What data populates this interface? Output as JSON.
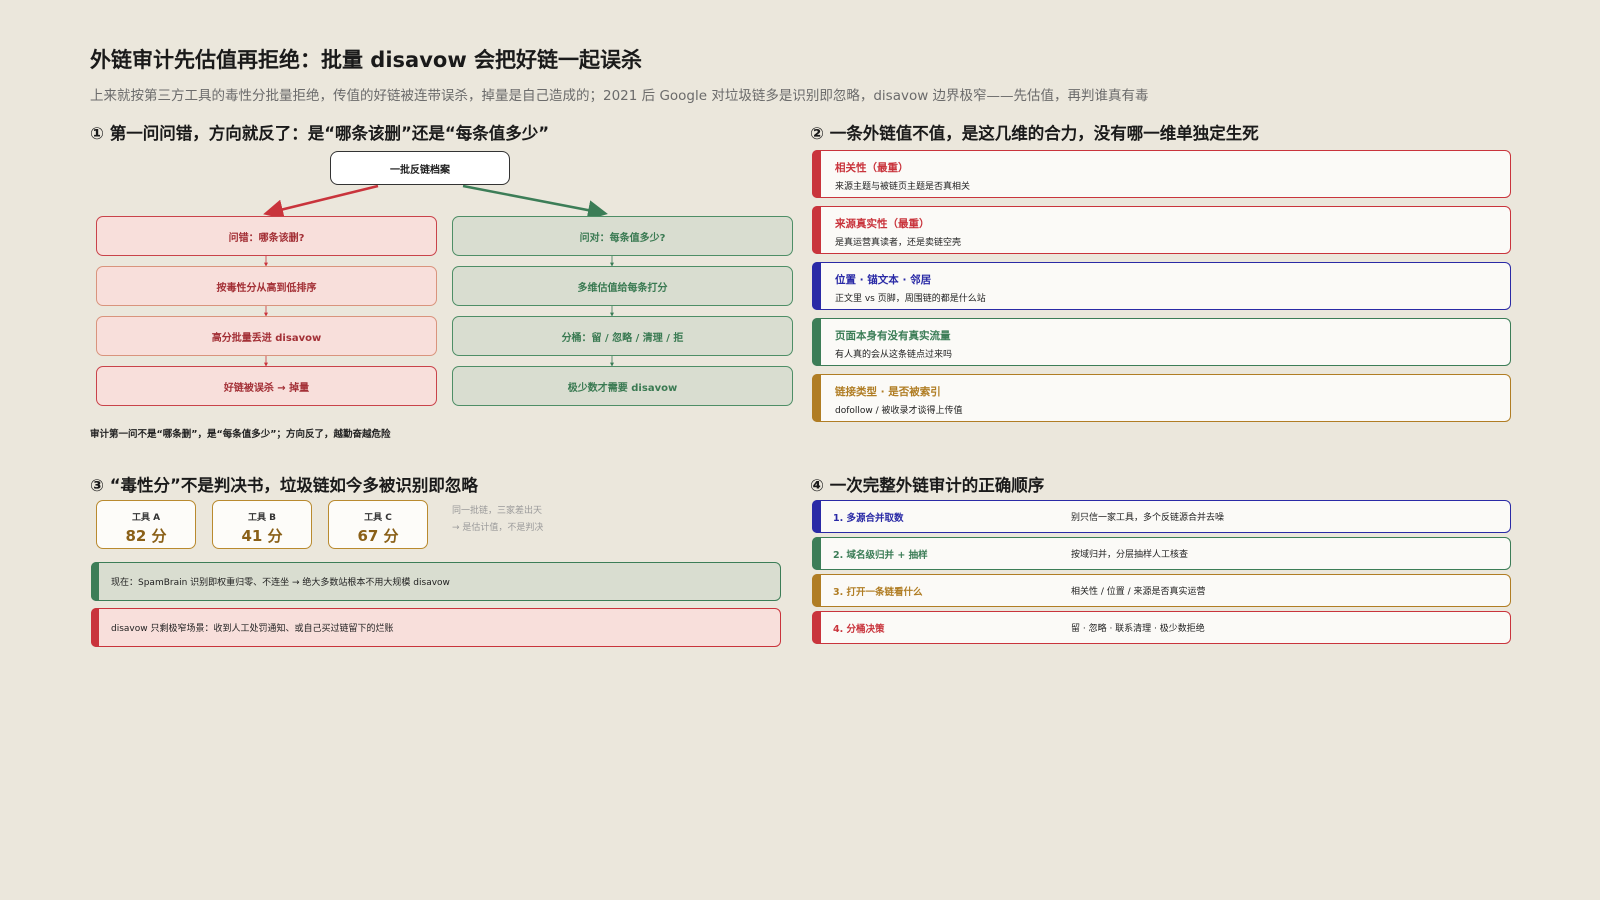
{
  "header": {
    "title": "外链审计先估值再拒绝：批量 disavow 会把好链一起误杀",
    "subtitle": "上来就按第三方工具的毒性分批量拒绝，传值的好链被连带误杀，掉量是自己造成的；2021 后 Google 对垃圾链多是识别即忽略，disavow 边界极窄——先估值，再判谁真有毒"
  },
  "section1": {
    "title": "① 第一问问错，方向就反了：是“哪条该删”还是“每条值多少”",
    "root": "一批反链档案",
    "wrong": [
      "问错：哪条该删?",
      "按毒性分从高到低排序",
      "高分批量丢进 disavow",
      "好链被误杀 → 掉量"
    ],
    "right": [
      "问对：每条值多少?",
      "多维估值给每条打分",
      "分桶：留 / 忽略 / 清理 / 拒",
      "极少数才需要 disavow"
    ],
    "caption": "审计第一问不是“哪条删”，是“每条值多少”；方向反了，越勤奋越危险"
  },
  "section2": {
    "title": "② 一条外链值不值，是这几维的合力，没有哪一维单独定生死",
    "factors": [
      {
        "title": "相关性（最重）",
        "desc": "来源主题与被链页主题是否真相关",
        "color": "#c9343c"
      },
      {
        "title": "来源真实性（最重）",
        "desc": "是真运营真读者，还是卖链空壳",
        "color": "#c9343c"
      },
      {
        "title": "位置 · 锚文本 · 邻居",
        "desc": "正文里 vs 页脚，周围链的都是什么站",
        "color": "#2a2aa6"
      },
      {
        "title": "页面本身有没有真实流量",
        "desc": "有人真的会从这条链点过来吗",
        "color": "#3c7d57"
      },
      {
        "title": "链接类型 · 是否被索引",
        "desc": "dofollow / 被收录才谈得上传值",
        "color": "#b07d24"
      }
    ]
  },
  "section3": {
    "title": "③ “毒性分”不是判决书，垃圾链如今多被识别即忽略",
    "tools": [
      {
        "name": "工具 A",
        "score": "82 分"
      },
      {
        "name": "工具 B",
        "score": "41 分"
      },
      {
        "name": "工具 C",
        "score": "67 分"
      }
    ],
    "side_note": [
      "同一批链，三家差出天",
      "→ 是估计值，不是判决"
    ],
    "notes": [
      {
        "text": "现在：SpamBrain 识别即权重归零、不连坐 → 绝大多数站根本不用大规模 disavow",
        "color": "#3c7d57",
        "bg": "#d9ddd0"
      },
      {
        "text": "disavow 只剩极窄场景：收到人工处罚通知、或自己买过链留下的烂账",
        "color": "#c9343c",
        "bg": "#f8dfdb"
      }
    ]
  },
  "section4": {
    "title": "④ 一次完整外链审计的正确顺序",
    "steps": [
      {
        "label": "1. 多源合并取数",
        "desc": "别只信一家工具，多个反链源合并去噪",
        "color": "#2a2aa6"
      },
      {
        "label": "2. 域名级归并 + 抽样",
        "desc": "按域归并，分层抽样人工核查",
        "color": "#3c7d57"
      },
      {
        "label": "3. 打开一条链看什么",
        "desc": "相关性 / 位置 / 来源是否真实运营",
        "color": "#b07d24"
      },
      {
        "label": "4. 分桶决策",
        "desc": "留 · 忽略 · 联系清理 · 极少数拒绝",
        "color": "#c9343c"
      }
    ]
  }
}
